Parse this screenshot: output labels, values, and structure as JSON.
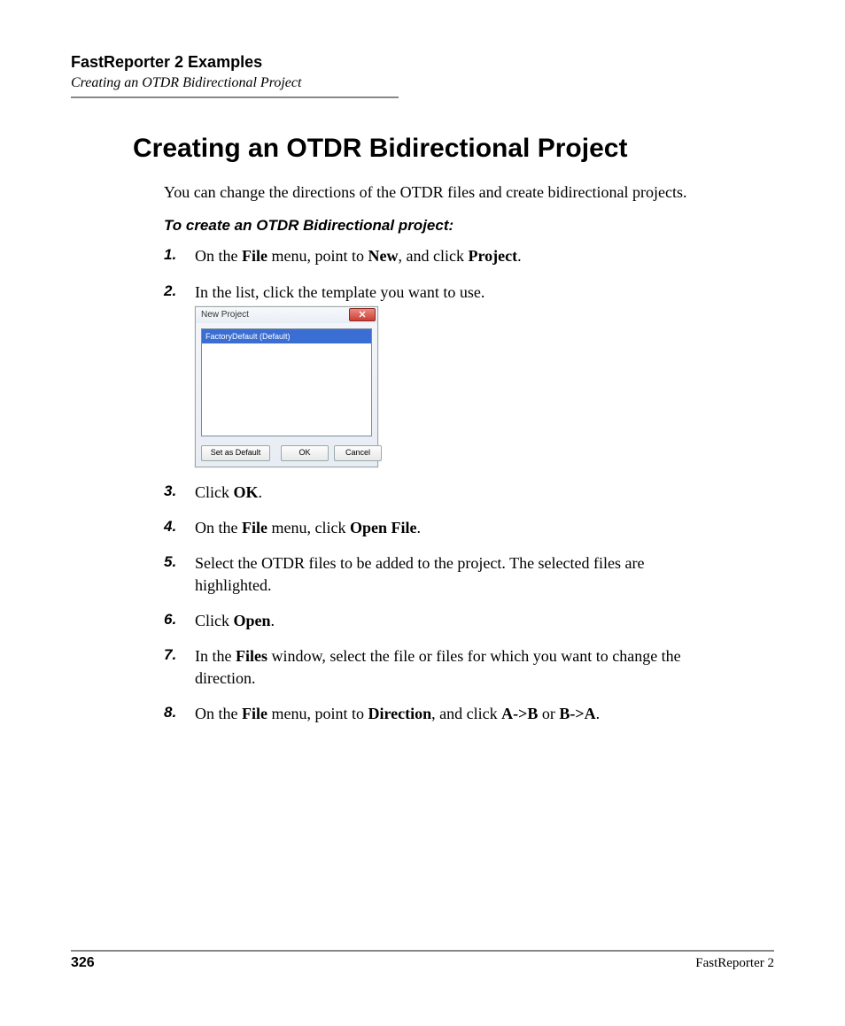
{
  "header": {
    "chapter": "FastReporter 2 Examples",
    "section": "Creating an OTDR Bidirectional Project"
  },
  "title": "Creating an OTDR Bidirectional Project",
  "intro": "You can change the directions of the OTDR files and create bidirectional projects.",
  "subheader": "To create an OTDR Bidirectional project:",
  "steps": {
    "s1_a": "On the ",
    "s1_b": "File",
    "s1_c": " menu, point to ",
    "s1_d": "New",
    "s1_e": ", and click ",
    "s1_f": "Project",
    "s1_g": ".",
    "s2": "In the list, click the template you want to use.",
    "s3_a": "Click ",
    "s3_b": "OK",
    "s3_c": ".",
    "s4_a": "On the ",
    "s4_b": "File",
    "s4_c": " menu, click ",
    "s4_d": "Open File",
    "s4_e": ".",
    "s5": "Select the OTDR files to be added to the project. The selected files are highlighted.",
    "s6_a": "Click ",
    "s6_b": "Open",
    "s6_c": ".",
    "s7_a": "In the ",
    "s7_b": "Files",
    "s7_c": " window, select the file or files for which you want to change the direction.",
    "s8_a": "On the ",
    "s8_b": "File",
    "s8_c": " menu, point to ",
    "s8_d": "Direction",
    "s8_e": ", and click ",
    "s8_f": "A->B",
    "s8_g": " or ",
    "s8_h": "B->A",
    "s8_i": "."
  },
  "nums": {
    "n1": "1.",
    "n2": "2.",
    "n3": "3.",
    "n4": "4.",
    "n5": "5.",
    "n6": "6.",
    "n7": "7.",
    "n8": "8."
  },
  "dialog": {
    "title": "New Project",
    "list_item": "FactoryDefault (Default)",
    "set_default": "Set as Default",
    "ok": "OK",
    "cancel": "Cancel"
  },
  "footer": {
    "page": "326",
    "product": "FastReporter 2"
  }
}
